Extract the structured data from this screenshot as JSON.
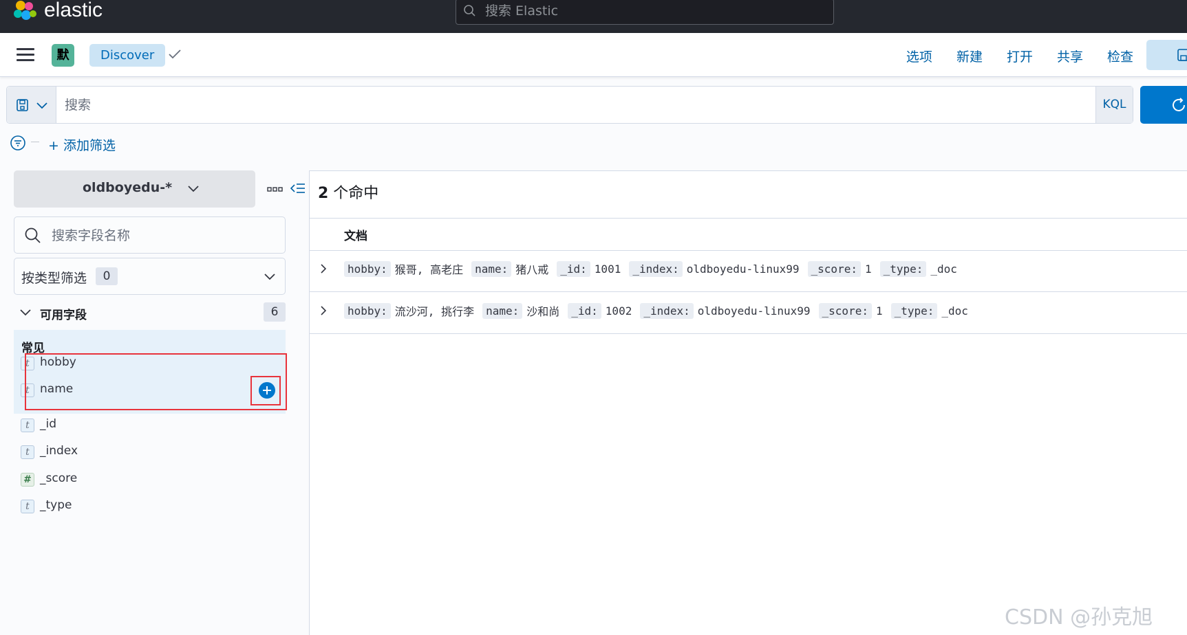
{
  "header": {
    "logo_text": "elastic",
    "search_placeholder": "搜索 Elastic"
  },
  "appbar": {
    "space_initial": "默",
    "breadcrumb": "Discover",
    "menu": [
      "选项",
      "新建",
      "打开",
      "共享",
      "检查"
    ]
  },
  "query": {
    "placeholder": "搜索",
    "language": "KQL"
  },
  "filters": {
    "add_filter": "+ 添加筛选"
  },
  "sidebar": {
    "index_pattern": "oldboyedu-*",
    "field_search_placeholder": "搜索字段名称",
    "type_filter_label": "按类型筛选",
    "type_filter_count": "0",
    "available_label": "可用字段",
    "available_count": "6",
    "common_label": "常见",
    "common_fields": [
      {
        "type": "t",
        "name": "hobby"
      },
      {
        "type": "t",
        "name": "name"
      }
    ],
    "other_fields": [
      {
        "type": "t",
        "name": "_id"
      },
      {
        "type": "t",
        "name": "_index"
      },
      {
        "type": "#",
        "name": "_score"
      },
      {
        "type": "t",
        "name": "_type"
      }
    ]
  },
  "results": {
    "hits_count": "2",
    "hits_label": " 个命中",
    "doc_column": "文档",
    "rows": [
      [
        {
          "k": "hobby:",
          "v": "猴哥, 高老庄"
        },
        {
          "k": "name:",
          "v": "猪八戒"
        },
        {
          "k": "_id:",
          "v": "1001"
        },
        {
          "k": "_index:",
          "v": "oldboyedu-linux99"
        },
        {
          "k": "_score:",
          "v": "1"
        },
        {
          "k": "_type:",
          "v": "_doc"
        }
      ],
      [
        {
          "k": "hobby:",
          "v": "流沙河, 挑行李"
        },
        {
          "k": "name:",
          "v": "沙和尚"
        },
        {
          "k": "_id:",
          "v": "1002"
        },
        {
          "k": "_index:",
          "v": "oldboyedu-linux99"
        },
        {
          "k": "_score:",
          "v": "1"
        },
        {
          "k": "_type:",
          "v": "_doc"
        }
      ]
    ]
  },
  "watermark": "CSDN @孙克旭",
  "colors": {
    "accent": "#0077cc",
    "link": "#0061a6",
    "highlight": "#e8333b",
    "header_bg": "#25282f"
  }
}
